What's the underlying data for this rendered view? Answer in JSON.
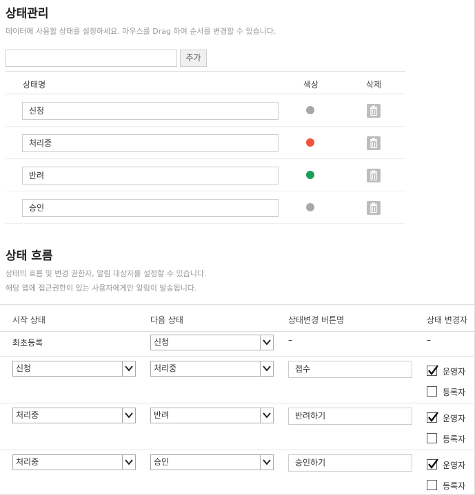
{
  "status_section": {
    "title": "상태관리",
    "description": "데이터에 사용할 상태를 설정하세요. 마우스를 Drag 하여 순서를 변경할 수 있습니다.",
    "new_status_value": "",
    "add_button": "추가",
    "columns": {
      "name": "상태명",
      "color": "색상",
      "delete": "삭제"
    },
    "statuses": [
      {
        "name": "신청",
        "color": "#a8a8a8"
      },
      {
        "name": "처리중",
        "color": "#f0533a"
      },
      {
        "name": "반려",
        "color": "#1a9f5a"
      },
      {
        "name": "승인",
        "color": "#a8a8a8"
      }
    ]
  },
  "flow_section": {
    "title": "상태 흐름",
    "description_line1": "상태의 흐름 및 변경 권한자, 알림 대상자를 설정할 수 있습니다.",
    "description_line2": "해당 앱에 접근권한이 있는 사용자에게만 알림이 발송됩니다.",
    "columns": {
      "start": "시작 상태",
      "next": "다음 상태",
      "button": "상태변경 버튼명",
      "changer": "상태 변경자"
    },
    "initial_row": {
      "start": "최초등록",
      "next": "신청",
      "button": "–",
      "changer": "–"
    },
    "rows": [
      {
        "start": "신청",
        "next": "처리중",
        "button": "접수",
        "operator_label": "운영자",
        "operator_checked": true,
        "registrant_label": "등록자",
        "registrant_checked": false
      },
      {
        "start": "처리중",
        "next": "반려",
        "button": "반려하기",
        "operator_label": "운영자",
        "operator_checked": true,
        "registrant_label": "등록자",
        "registrant_checked": false
      },
      {
        "start": "처리중",
        "next": "승인",
        "button": "승인하기",
        "operator_label": "운영자",
        "operator_checked": true,
        "registrant_label": "등록자",
        "registrant_checked": false
      }
    ]
  },
  "icons": {
    "trash": "trash-icon",
    "dropdown": "chevron-down-icon",
    "check": "checkmark-icon"
  }
}
